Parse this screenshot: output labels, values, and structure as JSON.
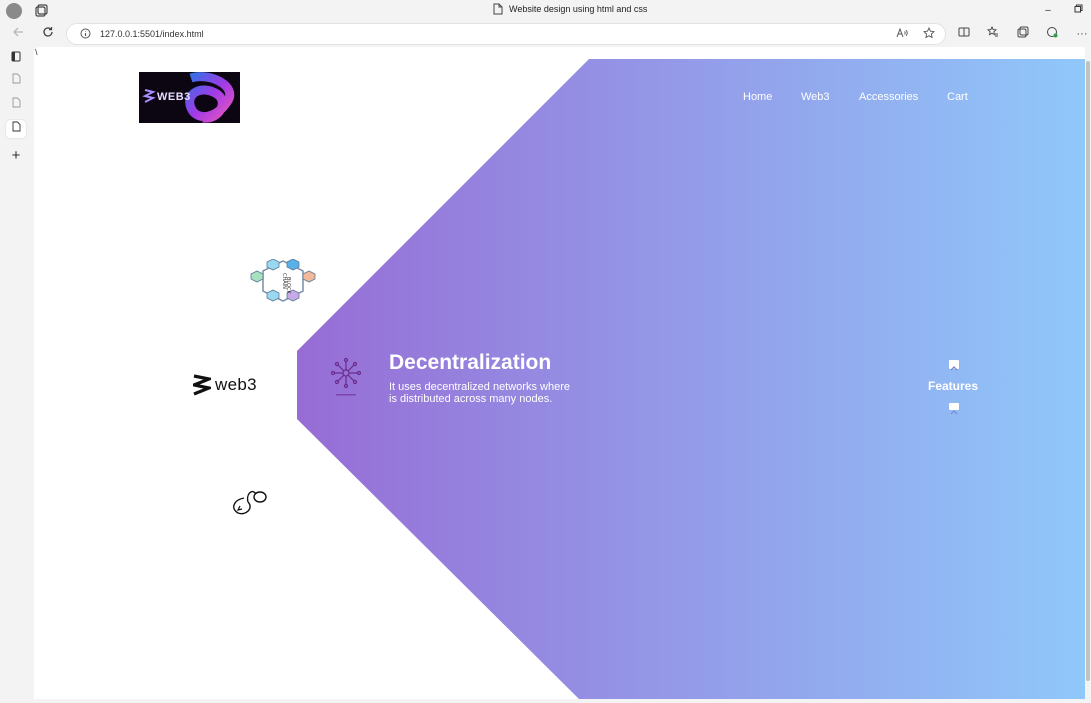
{
  "browser": {
    "tab_title": "Website design using html and css",
    "url": "127.0.0.1:5501/index.html"
  },
  "page": {
    "stray_text": "\\",
    "nav": {
      "items": [
        "Home",
        "Web3",
        "Accessories",
        "Cart"
      ]
    },
    "logo": {
      "text": "WEB3"
    },
    "brand_word": "web3",
    "hero": {
      "title": "Decentralization",
      "description": "It uses decentralized networks where is distributed across many nodes."
    },
    "features": {
      "label": "Features"
    },
    "colors": {
      "gradient_start": "#9a4cc7",
      "gradient_mid": "#9586e0",
      "gradient_end": "#90c8fa",
      "nav_text": "#ffffff"
    }
  }
}
